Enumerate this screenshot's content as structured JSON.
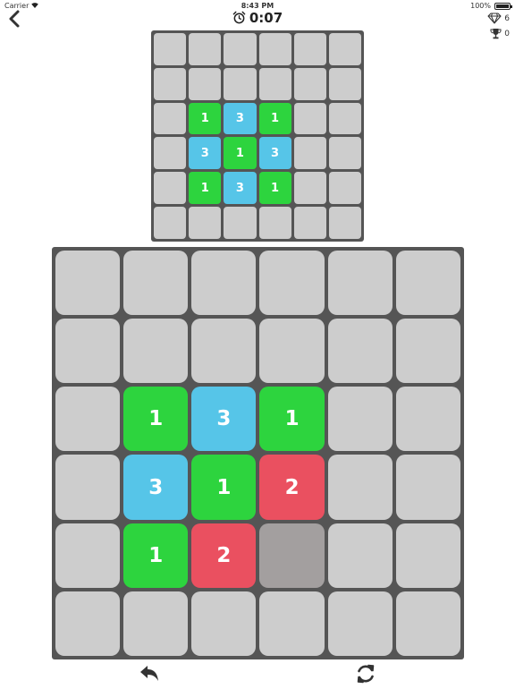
{
  "status_bar": {
    "carrier": "Carrier",
    "time": "8:43 PM",
    "battery": "100%"
  },
  "timer": "0:07",
  "stats": {
    "gems": "6",
    "trophies": "0"
  },
  "colors": {
    "green": "#2dd43e",
    "blue": "#56c5e8",
    "red": "#ea5060",
    "board_bg": "#555555",
    "empty": "#cdcdcd",
    "highlight": "#a39f9f"
  },
  "target_grid": [
    [
      "",
      "",
      "",
      "",
      "",
      ""
    ],
    [
      "",
      "",
      "",
      "",
      "",
      ""
    ],
    [
      "",
      "1",
      "3",
      "1",
      "",
      ""
    ],
    [
      "",
      "3",
      "1",
      "3",
      "",
      ""
    ],
    [
      "",
      "1",
      "3",
      "1",
      "",
      ""
    ],
    [
      "",
      "",
      "",
      "",
      "",
      ""
    ]
  ],
  "play_grid": [
    [
      "",
      "",
      "",
      "",
      "",
      ""
    ],
    [
      "",
      "",
      "",
      "",
      "",
      ""
    ],
    [
      "",
      "1",
      "3",
      "1",
      "",
      ""
    ],
    [
      "",
      "3",
      "1",
      "2",
      "",
      ""
    ],
    [
      "",
      "1",
      "2",
      "*",
      "",
      ""
    ],
    [
      "",
      "",
      "",
      "",
      "",
      ""
    ]
  ],
  "icons": {
    "back": "chevron-left-icon",
    "alarm": "alarm-clock-icon",
    "gem": "diamond-icon",
    "trophy": "trophy-icon",
    "undo": "undo-icon",
    "restart": "refresh-icon"
  }
}
